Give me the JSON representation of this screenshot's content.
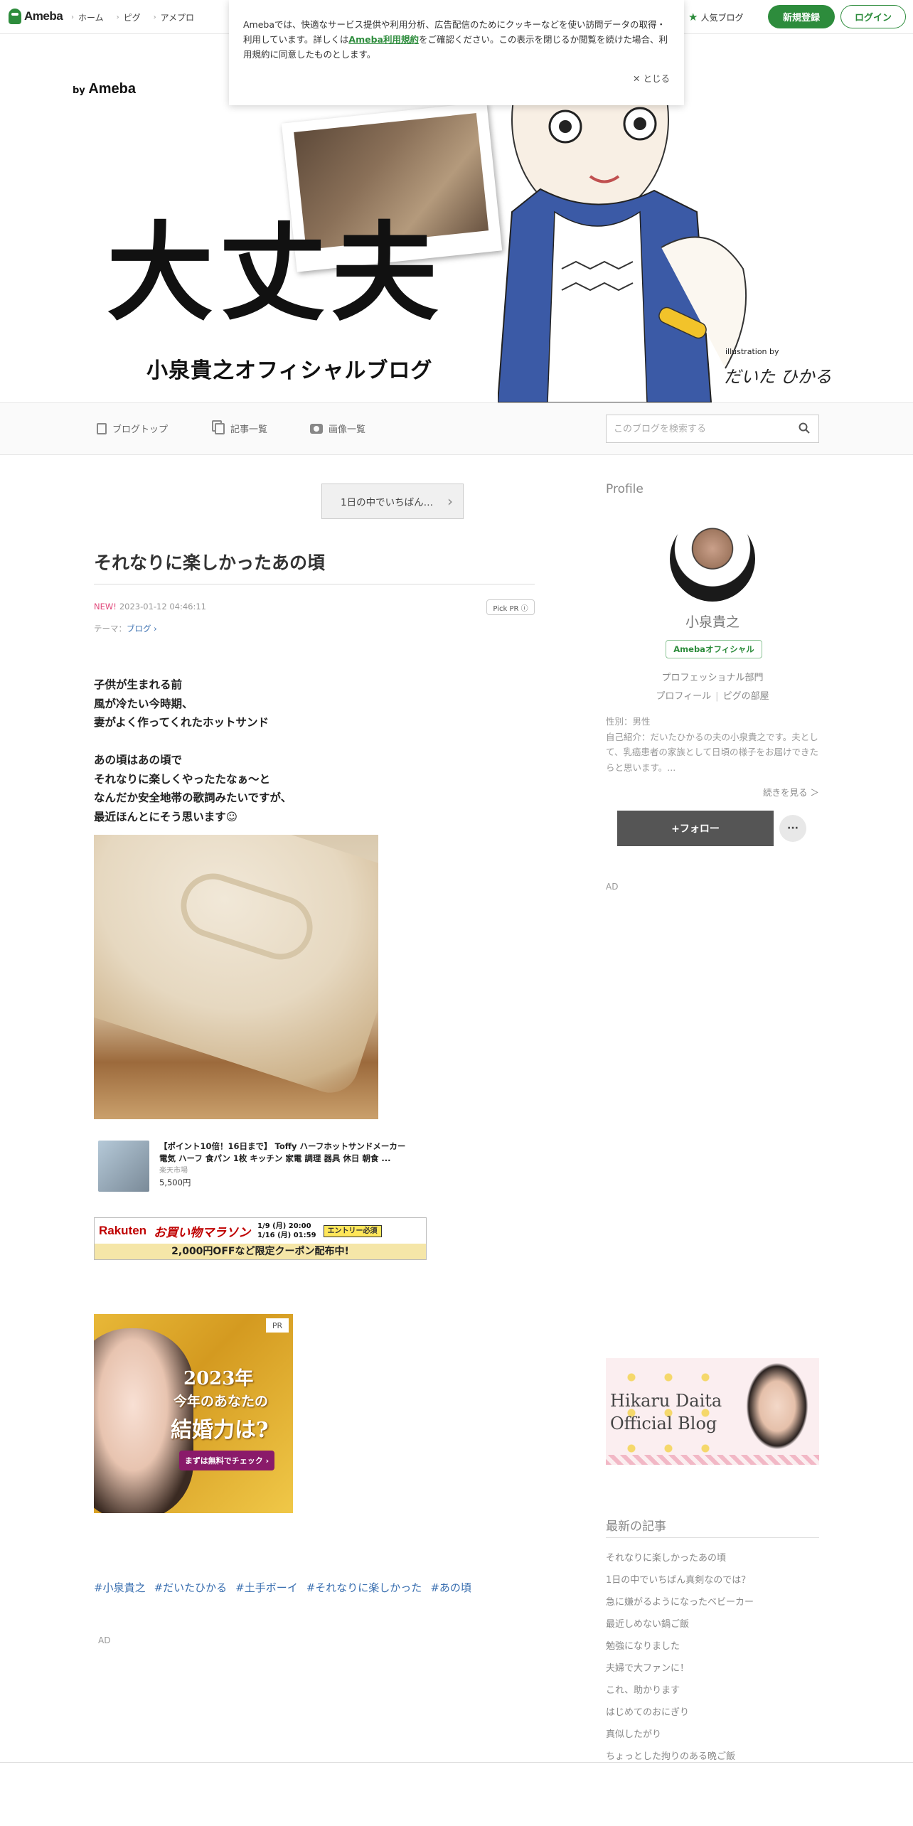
{
  "topbar": {
    "logo": "Ameba",
    "nav": [
      "ホーム",
      "ピグ",
      "アメプロ"
    ],
    "popular": "人気ブログ",
    "signup": "新規登録",
    "login": "ログイン"
  },
  "cookie": {
    "text_before": "Amebaでは、快適なサービス提供や利用分析、広告配信のためにクッキーなどを使い訪問データの取得・利用しています。詳しくは",
    "link": "Ameba利用規約",
    "text_after": "をご確認ください。この表示を閉じるか閲覧を続けた場合、利用規約に同意したものとします。",
    "close": "とじる"
  },
  "header": {
    "by": "by",
    "brand": "Ameba",
    "title": "大丈夫",
    "subtitle": "小泉貴之オフィシャルブログ",
    "illustration_by": "illustration by",
    "illustrator": "だいた ひかる"
  },
  "blognav": {
    "top": "ブログトップ",
    "list": "記事一覧",
    "images": "画像一覧",
    "search_placeholder": "このブログを検索する"
  },
  "entry": {
    "ranking": "1日の中でいちばん…",
    "title": "それなりに楽しかったあの頃",
    "new": "NEW!",
    "date": "2023-01-12 04:46:11",
    "pickpr": "Pick PR ⓘ",
    "theme_label": "テーマ：",
    "theme": "ブログ",
    "body": [
      "子供が生まれる前",
      "風が冷たい今時期、",
      "妻がよく作ってくれたホットサンド",
      "",
      "あの頃はあの頃で",
      "それなりに楽しくやったたなぁ〜と",
      "なんだか安全地帯の歌詞みたいですが、",
      "最近ほんとにそう思います☺︎"
    ],
    "product": {
      "title": "【ポイント10倍！16日まで】 Toffy ハーフホットサンドメーカー 電気 ハーフ 食パン 1枚 キッチン 家電 調理 器具 休日 朝食 ...",
      "shop": "楽天市場",
      "price": "5,500円"
    },
    "rakuten": {
      "brand": "Rakuten",
      "campaign": "お買い物マラソン",
      "date1": "1/9 (月) 20:00",
      "date2": "1/16 (月) 01:59",
      "entry": "エントリー必須",
      "coupon": "2,000円OFFなど限定クーポン配布中!"
    },
    "pr": {
      "tag": "PR",
      "year": "2023年",
      "line2": "今年のあなたの",
      "line3": "結婚力は?",
      "cta": "まずは無料でチェック ›"
    },
    "hashtags": [
      "#小泉貴之",
      "#だいたひかる",
      "#土手ボーイ",
      "#それなりに楽しかった",
      "#あの頃"
    ],
    "ad": "AD"
  },
  "sidebar": {
    "profile_head": "Profile",
    "name": "小泉貴之",
    "official": "Amebaオフィシャル",
    "dept": "プロフェッショナル部門",
    "link_profile": "プロフィール",
    "link_pig": "ピグの部屋",
    "gender": "性別：男性",
    "bio": "自己紹介：だいたひかるの夫の小泉貴之です。夫として、乳癌患者の家族として日頃の様子をお届けできたらと思います。...",
    "more": "続きを見る ＞",
    "follow": "+フォロー",
    "dots": "···",
    "ad": "AD",
    "banner_l1": "Hikaru Daita",
    "banner_l2": "Official Blog",
    "recent_head": "最新の記事",
    "recent": [
      "それなりに楽しかったあの頃",
      "1日の中でいちばん真剣なのでは？",
      "急に嫌がるようになったベビーカー",
      "最近しめない鍋ご飯",
      "勉強になりました",
      "夫婦で大ファンに！",
      "これ、助かります",
      "はじめてのおにぎり",
      "真似したがり",
      "ちょっとした拘りのある晩ご飯"
    ]
  }
}
